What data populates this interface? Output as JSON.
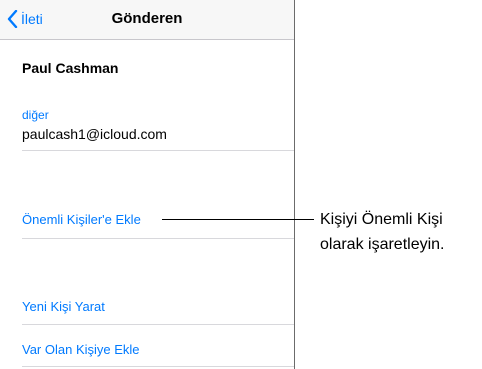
{
  "navbar": {
    "back_label": "İleti",
    "title": "Gönderen"
  },
  "contact": {
    "name": "Paul Cashman",
    "email_label": "diğer",
    "email_value": "paulcash1@icloud.com"
  },
  "actions": {
    "add_vip": "Önemli Kişiler'e Ekle",
    "create_new_contact": "Yeni Kişi Yarat",
    "add_to_existing": "Var Olan Kişiye Ekle"
  },
  "callout": {
    "line1": "Kişiyi Önemli Kişi",
    "line2": "olarak işaretleyin."
  },
  "colors": {
    "accent": "#007aff",
    "navbar_bg": "#f7f7f7",
    "group_bg": "#efeff4"
  }
}
